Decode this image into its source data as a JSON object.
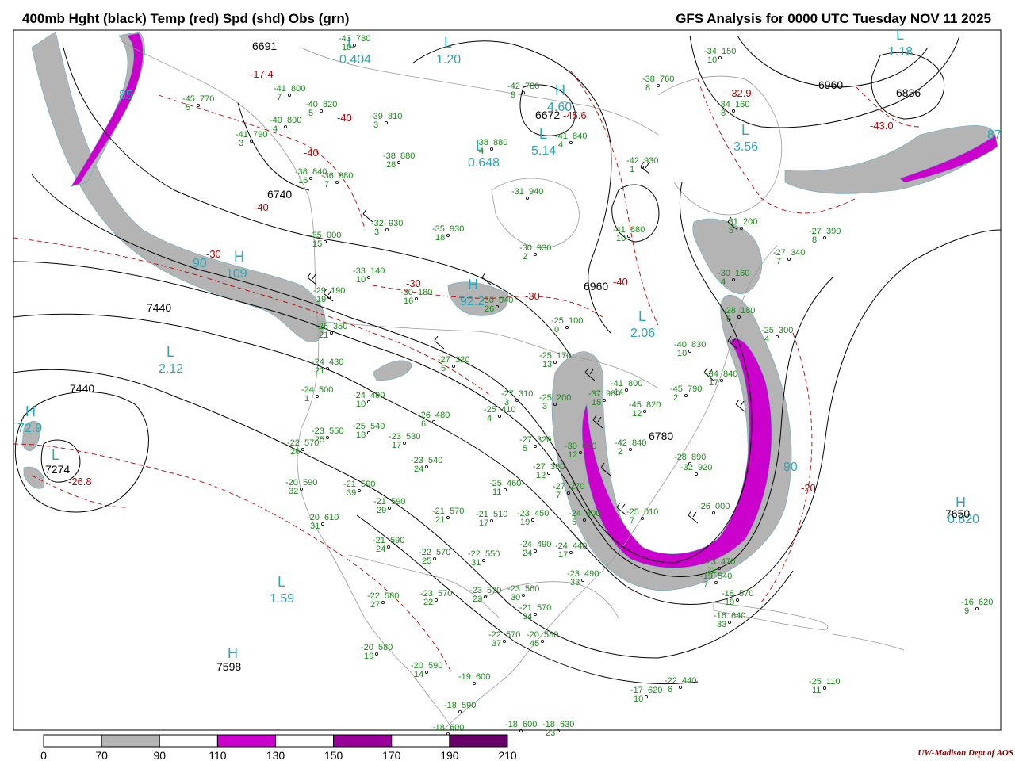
{
  "title_left": "400mb Hght (black) Temp (red) Spd (shd) Obs (grn)",
  "title_right": "GFS Analysis for 0000 UTC Tuesday  NOV 11 2025",
  "credit": "UW-Madison   Dept of AOS",
  "colors": {
    "height": "#000000",
    "temp": "#c00000",
    "obs": "#1a8a1a",
    "label": "#28a8b8",
    "coast": "#999999",
    "spd_70": "#b4b4b4",
    "spd_110": "#cc00cc",
    "spd_150": "#990099",
    "spd_190": "#660066"
  },
  "speed_scale": {
    "ticks": [
      "0",
      "70",
      "90",
      "110",
      "130",
      "150",
      "170",
      "190",
      "210"
    ],
    "fills": [
      "#ffffff",
      "#b4b4b4",
      "#ffffff",
      "#cc00cc",
      "#ffffff",
      "#990099",
      "#ffffff",
      "#660066"
    ]
  },
  "pressure_centers": [
    {
      "letter": "L",
      "value": "1.20"
    },
    {
      "letter": "L",
      "value": "0.404"
    },
    {
      "letter": "L",
      "value": "0.648"
    },
    {
      "letter": "L",
      "value": "5.14"
    },
    {
      "letter": "H",
      "value": "4.60"
    },
    {
      "letter": "L",
      "value": "3.56"
    },
    {
      "letter": "L",
      "value": "1.18"
    },
    {
      "letter": "H",
      "value": "109"
    },
    {
      "letter": "L",
      "value": "2.12"
    },
    {
      "letter": "H",
      "value": "72.9"
    },
    {
      "letter": "H",
      "value": "92.2"
    },
    {
      "letter": "L",
      "value": "2.06"
    },
    {
      "letter": "H",
      "value": "0.820"
    },
    {
      "letter": "L",
      "value": "1.59"
    },
    {
      "letter": "H",
      "value": ""
    },
    {
      "letter": "L",
      "value": ""
    }
  ],
  "height_labels": [
    "6740",
    "6672",
    "6960",
    "6960",
    "6836",
    "7440",
    "7440",
    "7274",
    "7598",
    "6780",
    "7650",
    "6691"
  ],
  "temp_labels": [
    "-17.4",
    "-40",
    "-40",
    "-40",
    "-30",
    "-30",
    "-30",
    "-40",
    "-32.9",
    "-43.0",
    "-45.6",
    "-26.8",
    "-20"
  ],
  "speed_labels": [
    "90",
    "90",
    "85",
    "87"
  ],
  "observations": [
    {
      "t": "-43",
      "h": "780",
      "d": "10"
    },
    {
      "t": "-41",
      "h": "800",
      "d": "7"
    },
    {
      "t": "-45",
      "h": "770",
      "d": "5"
    },
    {
      "t": "-40",
      "h": "820",
      "d": "5"
    },
    {
      "t": "-41",
      "h": "790",
      "d": "3"
    },
    {
      "t": "-40",
      "h": "800",
      "d": "4"
    },
    {
      "t": "-38",
      "h": "840",
      "d": "16"
    },
    {
      "t": "-39",
      "h": "810",
      "d": "3"
    },
    {
      "t": "-38",
      "h": "880",
      "d": "28"
    },
    {
      "t": "-36",
      "h": "880",
      "d": "7"
    },
    {
      "t": "-42",
      "h": "780",
      "d": "9"
    },
    {
      "t": "-38",
      "h": "880",
      "d": "4"
    },
    {
      "t": "-41",
      "h": "840",
      "d": "4"
    },
    {
      "t": "-31",
      "h": "940",
      "d": ""
    },
    {
      "t": "-34",
      "h": "150",
      "d": "10"
    },
    {
      "t": "-34",
      "h": "160",
      "d": "8"
    },
    {
      "t": "-38",
      "h": "760",
      "d": "8"
    },
    {
      "t": "-42",
      "h": "930",
      "d": "1"
    },
    {
      "t": "-41",
      "h": "880",
      "d": "10"
    },
    {
      "t": "-35",
      "h": "000",
      "d": "15"
    },
    {
      "t": "-32",
      "h": "930",
      "d": "3"
    },
    {
      "t": "-35",
      "h": "930",
      "d": "18"
    },
    {
      "t": "-30",
      "h": "930",
      "d": "2"
    },
    {
      "t": "-33",
      "h": "140",
      "d": "10"
    },
    {
      "t": "-29",
      "h": "190",
      "d": "19"
    },
    {
      "t": "-30",
      "h": "180",
      "d": "16"
    },
    {
      "t": "-30",
      "h": "040",
      "d": "26"
    },
    {
      "t": "-25",
      "h": "100",
      "d": "0"
    },
    {
      "t": "-25",
      "h": "170",
      "d": "13"
    },
    {
      "t": "-26",
      "h": "350",
      "d": "21"
    },
    {
      "t": "-24",
      "h": "430",
      "d": "21"
    },
    {
      "t": "-27",
      "h": "320",
      "d": "5"
    },
    {
      "t": "-24",
      "h": "500",
      "d": "1"
    },
    {
      "t": "-24",
      "h": "490",
      "d": "10"
    },
    {
      "t": "-27",
      "h": "310",
      "d": "3"
    },
    {
      "t": "-25",
      "h": "200",
      "d": "3"
    },
    {
      "t": "-37",
      "h": "980",
      "d": "15"
    },
    {
      "t": "-41",
      "h": "800",
      "d": "14"
    },
    {
      "t": "-45",
      "h": "790",
      "d": "2"
    },
    {
      "t": "-45",
      "h": "820",
      "d": "12"
    },
    {
      "t": "-40",
      "h": "830",
      "d": "10"
    },
    {
      "t": "-34",
      "h": "840",
      "d": "17"
    },
    {
      "t": "-31",
      "h": "200",
      "d": "5"
    },
    {
      "t": "-27",
      "h": "390",
      "d": "8"
    },
    {
      "t": "-27",
      "h": "340",
      "d": "7"
    },
    {
      "t": "-30",
      "h": "160",
      "d": "4"
    },
    {
      "t": "-28",
      "h": "180",
      "d": "6"
    },
    {
      "t": "-25",
      "h": "300",
      "d": "4"
    },
    {
      "t": "-26",
      "h": "480",
      "d": "6"
    },
    {
      "t": "-25",
      "h": "410",
      "d": "4"
    },
    {
      "t": "-23",
      "h": "550",
      "d": "25"
    },
    {
      "t": "-25",
      "h": "540",
      "d": "18"
    },
    {
      "t": "-23",
      "h": "530",
      "d": "17"
    },
    {
      "t": "-22",
      "h": "570",
      "d": "26"
    },
    {
      "t": "-23",
      "h": "540",
      "d": "24"
    },
    {
      "t": "-27",
      "h": "320",
      "d": "5"
    },
    {
      "t": "-30",
      "h": "000",
      "d": "12"
    },
    {
      "t": "-27",
      "h": "330",
      "d": "12"
    },
    {
      "t": "-20",
      "h": "590",
      "d": "32"
    },
    {
      "t": "-21",
      "h": "590",
      "d": "39"
    },
    {
      "t": "-21",
      "h": "590",
      "d": "29"
    },
    {
      "t": "-25",
      "h": "460",
      "d": "11"
    },
    {
      "t": "-27",
      "h": "270",
      "d": "7"
    },
    {
      "t": "-20",
      "h": "610",
      "d": "31"
    },
    {
      "t": "-21",
      "h": "570",
      "d": "21"
    },
    {
      "t": "-21",
      "h": "510",
      "d": "17"
    },
    {
      "t": "-23",
      "h": "450",
      "d": "19"
    },
    {
      "t": "-24",
      "h": "300",
      "d": "5"
    },
    {
      "t": "-21",
      "h": "590",
      "d": "24"
    },
    {
      "t": "-22",
      "h": "570",
      "d": "25"
    },
    {
      "t": "-22",
      "h": "550",
      "d": "31"
    },
    {
      "t": "-24",
      "h": "490",
      "d": "24"
    },
    {
      "t": "-24",
      "h": "440",
      "d": "17"
    },
    {
      "t": "-23",
      "h": "490",
      "d": "33"
    },
    {
      "t": "-22",
      "h": "580",
      "d": "27"
    },
    {
      "t": "-23",
      "h": "570",
      "d": "22"
    },
    {
      "t": "-23",
      "h": "570",
      "d": "23"
    },
    {
      "t": "-23",
      "h": "560",
      "d": "30"
    },
    {
      "t": "-21",
      "h": "570",
      "d": "34"
    },
    {
      "t": "-22",
      "h": "570",
      "d": "37"
    },
    {
      "t": "-20",
      "h": "580",
      "d": "45"
    },
    {
      "t": "-20",
      "h": "580",
      "d": "19"
    },
    {
      "t": "-20",
      "h": "590",
      "d": "14"
    },
    {
      "t": "-19",
      "h": "600",
      "d": ""
    },
    {
      "t": "-18",
      "h": "590",
      "d": ""
    },
    {
      "t": "-18",
      "h": "600",
      "d": ""
    },
    {
      "t": "-18",
      "h": "600",
      "d": ""
    },
    {
      "t": "-18",
      "h": "630",
      "d": "23"
    },
    {
      "t": "-17",
      "h": "620",
      "d": "10"
    },
    {
      "t": "-22",
      "h": "440",
      "d": "6"
    },
    {
      "t": "-23",
      "h": "470",
      "d": "21"
    },
    {
      "t": "-19",
      "h": "540",
      "d": "7"
    },
    {
      "t": "-18",
      "h": "570",
      "d": "19"
    },
    {
      "t": "-16",
      "h": "640",
      "d": "33"
    },
    {
      "t": "-16",
      "h": "620",
      "d": "9"
    },
    {
      "t": "-25",
      "h": "110",
      "d": "11"
    },
    {
      "t": "-26",
      "h": "000",
      "d": ""
    },
    {
      "t": "-25",
      "h": "010",
      "d": "7"
    },
    {
      "t": "-42",
      "h": "840",
      "d": "2"
    },
    {
      "t": "-28",
      "h": "890",
      "d": ""
    },
    {
      "t": "-32",
      "h": "920",
      "d": ""
    }
  ]
}
